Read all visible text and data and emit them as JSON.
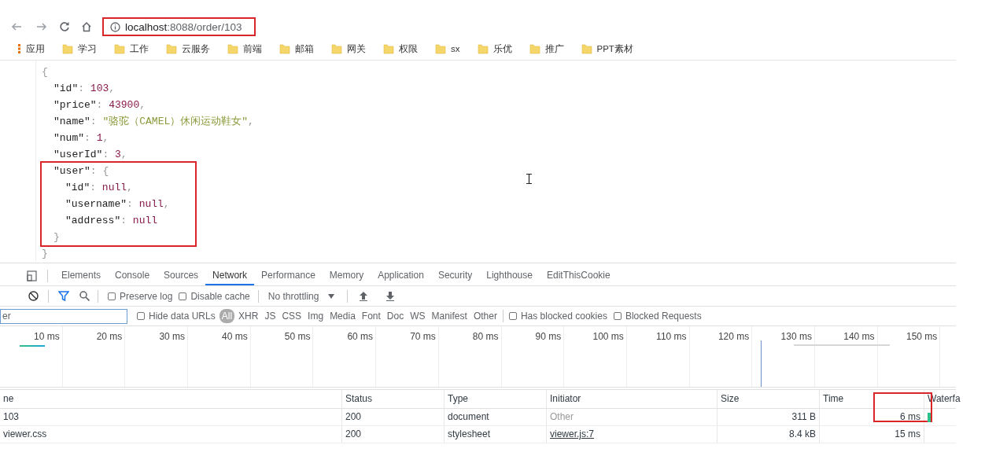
{
  "browser": {
    "url_host": "localhost",
    "url_path": ":8088/order/103",
    "url_highlighted": true
  },
  "bookmarks": [
    {
      "kind": "apps",
      "label": "应用"
    },
    {
      "kind": "folder",
      "label": "学习"
    },
    {
      "kind": "folder",
      "label": "工作"
    },
    {
      "kind": "folder",
      "label": "云服务"
    },
    {
      "kind": "folder",
      "label": "前端"
    },
    {
      "kind": "folder",
      "label": "邮箱"
    },
    {
      "kind": "folder",
      "label": "网关"
    },
    {
      "kind": "folder",
      "label": "权限"
    },
    {
      "kind": "folder",
      "label": "sx"
    },
    {
      "kind": "folder",
      "label": "乐优"
    },
    {
      "kind": "folder",
      "label": "推广"
    },
    {
      "kind": "folder",
      "label": "PPT素材"
    }
  ],
  "json_view": {
    "lines": [
      {
        "tokens": [
          {
            "kind": "punct",
            "text": "{"
          }
        ],
        "closing": [
          {
            "kind": "punct",
            "text": "}"
          }
        ],
        "children": [
          {
            "tokens": [
              {
                "kind": "key",
                "text": "\"id\""
              },
              {
                "kind": "punct",
                "text": ": "
              },
              {
                "kind": "number",
                "text": "103"
              },
              {
                "kind": "punct",
                "text": ","
              }
            ]
          },
          {
            "tokens": [
              {
                "kind": "key",
                "text": "\"price\""
              },
              {
                "kind": "punct",
                "text": ": "
              },
              {
                "kind": "number",
                "text": "43900"
              },
              {
                "kind": "punct",
                "text": ","
              }
            ]
          },
          {
            "tokens": [
              {
                "kind": "key",
                "text": "\"name\""
              },
              {
                "kind": "punct",
                "text": ": "
              },
              {
                "kind": "string",
                "text": "\"骆驼（CAMEL）休闲运动鞋女\""
              },
              {
                "kind": "punct",
                "text": ","
              }
            ]
          },
          {
            "tokens": [
              {
                "kind": "key",
                "text": "\"num\""
              },
              {
                "kind": "punct",
                "text": ": "
              },
              {
                "kind": "number",
                "text": "1"
              },
              {
                "kind": "punct",
                "text": ","
              }
            ]
          },
          {
            "tokens": [
              {
                "kind": "key",
                "text": "\"userId\""
              },
              {
                "kind": "punct",
                "text": ": "
              },
              {
                "kind": "number",
                "text": "3"
              },
              {
                "kind": "punct",
                "text": ","
              }
            ]
          },
          {
            "tokens": [
              {
                "kind": "key",
                "text": "\"user\""
              },
              {
                "kind": "punct",
                "text": ": {"
              }
            ],
            "closing": [
              {
                "kind": "punct",
                "text": "}"
              }
            ],
            "highlighted": true,
            "children": [
              {
                "tokens": [
                  {
                    "kind": "key",
                    "text": "\"id\""
                  },
                  {
                    "kind": "punct",
                    "text": ": "
                  },
                  {
                    "kind": "null",
                    "text": "null"
                  },
                  {
                    "kind": "punct",
                    "text": ","
                  }
                ]
              },
              {
                "tokens": [
                  {
                    "kind": "key",
                    "text": "\"username\""
                  },
                  {
                    "kind": "punct",
                    "text": ": "
                  },
                  {
                    "kind": "null",
                    "text": "null"
                  },
                  {
                    "kind": "punct",
                    "text": ","
                  }
                ]
              },
              {
                "tokens": [
                  {
                    "kind": "key",
                    "text": "\"address\""
                  },
                  {
                    "kind": "punct",
                    "text": ": "
                  },
                  {
                    "kind": "null",
                    "text": "null"
                  }
                ]
              }
            ]
          }
        ]
      }
    ]
  },
  "devtools": {
    "tabs": [
      {
        "label": "Elements",
        "selected": false
      },
      {
        "label": "Console",
        "selected": false
      },
      {
        "label": "Sources",
        "selected": false
      },
      {
        "label": "Network",
        "selected": true
      },
      {
        "label": "Performance",
        "selected": false
      },
      {
        "label": "Memory",
        "selected": false
      },
      {
        "label": "Application",
        "selected": false
      },
      {
        "label": "Security",
        "selected": false
      },
      {
        "label": "Lighthouse",
        "selected": false
      },
      {
        "label": "EditThisCookie",
        "selected": false
      }
    ],
    "toolbar": {
      "filter_active": true,
      "preserve_log": {
        "label": "Preserve log",
        "checked": false
      },
      "disable_cache": {
        "label": "Disable cache",
        "checked": false
      },
      "throttling": "No throttling"
    },
    "filter": {
      "placeholder": "er",
      "hide_data_urls": {
        "label": "Hide data URLs",
        "checked": false
      },
      "types": [
        {
          "label": "All",
          "selected": true
        },
        {
          "label": "XHR",
          "selected": false
        },
        {
          "label": "JS",
          "selected": false
        },
        {
          "label": "CSS",
          "selected": false
        },
        {
          "label": "Img",
          "selected": false
        },
        {
          "label": "Media",
          "selected": false
        },
        {
          "label": "Font",
          "selected": false
        },
        {
          "label": "Doc",
          "selected": false
        },
        {
          "label": "WS",
          "selected": false
        },
        {
          "label": "Manifest",
          "selected": false
        },
        {
          "label": "Other",
          "selected": false
        }
      ],
      "has_blocked_cookies": {
        "label": "Has blocked cookies",
        "checked": false
      },
      "blocked_requests": {
        "label": "Blocked Requests",
        "checked": false
      }
    },
    "timeline": {
      "ticks": [
        "10 ms",
        "20 ms",
        "30 ms",
        "40 ms",
        "50 ms",
        "60 ms",
        "70 ms",
        "80 ms",
        "90 ms",
        "100 ms",
        "110 ms",
        "120 ms",
        "130 ms",
        "140 ms",
        "150 ms"
      ]
    },
    "table": {
      "columns": [
        "ne",
        "Status",
        "Type",
        "Initiator",
        "Size",
        "Time",
        "Waterfa"
      ],
      "rows": [
        {
          "name": "103",
          "status": "200",
          "type": "document",
          "initiator": "Other",
          "initiator_link": false,
          "size": "311 B",
          "time": "6 ms",
          "time_highlighted": true,
          "waterfall": true
        },
        {
          "name": "viewer.css",
          "status": "200",
          "type": "stylesheet",
          "initiator": "viewer.js:7",
          "initiator_link": true,
          "size": "8.4 kB",
          "time": "15 ms",
          "time_highlighted": false,
          "waterfall": false
        }
      ]
    }
  }
}
